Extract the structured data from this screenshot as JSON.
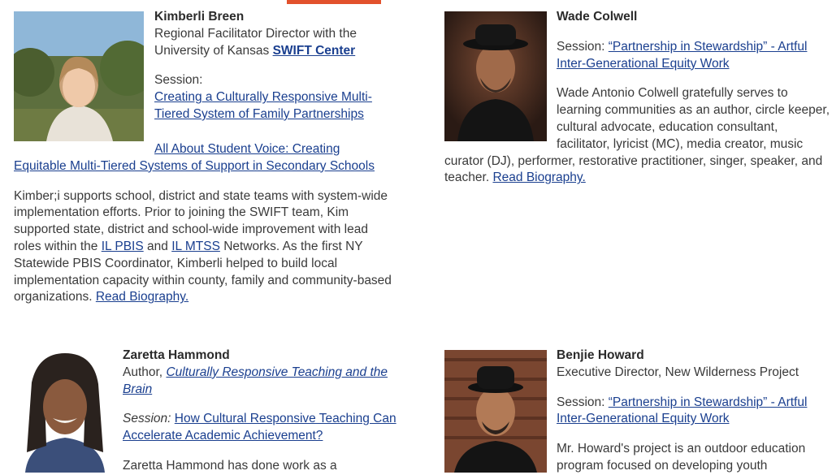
{
  "people": [
    {
      "name": "Kimberli Breen",
      "title_prefix": "Regional Facilitator Director with the University of Kansas",
      "title_link": "SWIFT Center",
      "session_label": "Session:",
      "session_1": "Creating a Culturally Responsive Multi-Tiered System of Family Partnerships",
      "session_2": "All About Student Voice: Creating Equitable Multi-Tiered Systems of Support in Secondary Schools",
      "bio_1": "Kimber;i supports school, district and state teams with system-wide implementation efforts. Prior to joining the SWIFT team, Kim supported state, district and school-wide improvement with lead roles within the",
      "bio_link_1": "IL PBIS",
      "bio_and": "and",
      "bio_link_2": "IL MTSS",
      "bio_2": "Networks. As the first NY Statewide PBIS Coordinator, Kimberli helped to build local implementation capacity within county, family and community-based organizations.",
      "read_more": "Read Biography."
    },
    {
      "name": "Wade Colwell",
      "session_label": "Session:",
      "session_1": "“Partnership in Stewardship” - Artful Inter-Generational Equity Work",
      "bio": "Wade Antonio Colwell gratefully serves to learning communities as an author, circle keeper, cultural advocate, education consultant, facilitator, lyricist (MC), media creator, music curator (DJ), performer, restorative practitioner, singer, speaker, and teacher.",
      "read_more": "Read Biography."
    },
    {
      "name": "Zaretta Hammond",
      "title_prefix": "Author,",
      "title_link": "Culturally Responsive Teaching and the Brain",
      "session_label": "Session:",
      "session_1": "How Cultural Responsive Teaching Can Accelerate Academic Achievement?",
      "bio": "Zaretta Hammond has done work as a"
    },
    {
      "name": "Benjie Howard",
      "title": "Executive Director, New Wilderness Project",
      "session_label": "Session:",
      "session_1": "“Partnership in Stewardship” - Artful Inter-Generational Equity Work",
      "bio": "Mr. Howard's project is an outdoor education program focused on developing youth"
    }
  ],
  "colors": {
    "accent": "#e2512c",
    "link": "#1a3f8f",
    "text": "#3a3a3a"
  }
}
